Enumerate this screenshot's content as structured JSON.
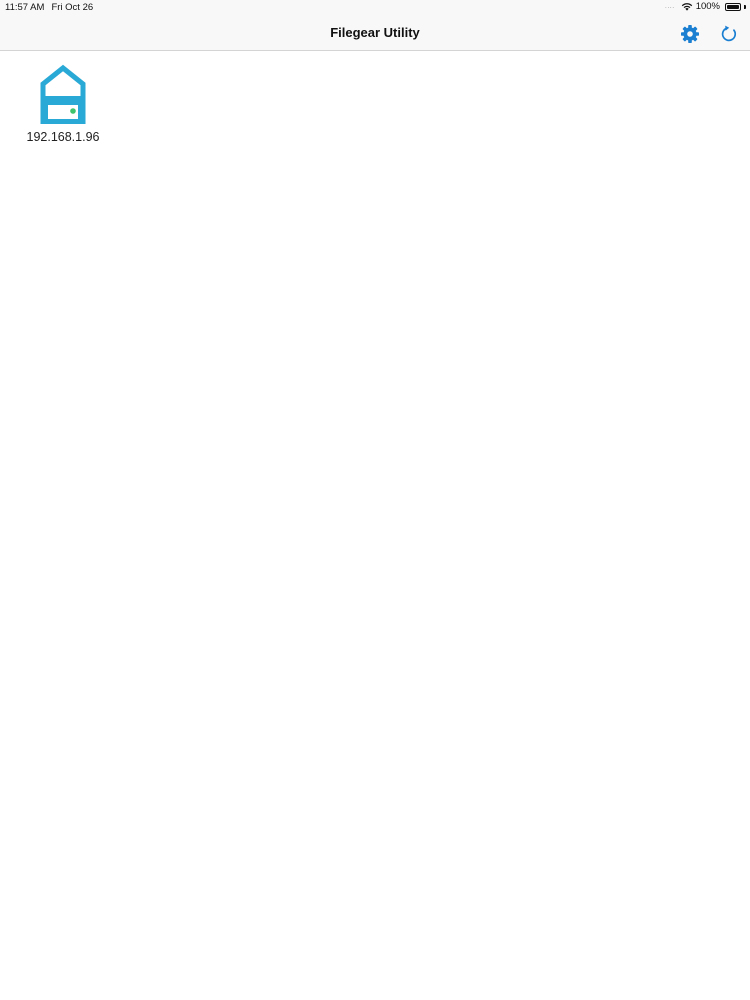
{
  "status_bar": {
    "time": "11:57 AM",
    "date": "Fri Oct 26",
    "signal": "....",
    "wifi_icon": "wifi-icon",
    "battery_percent": "100%",
    "battery_level": 1.0
  },
  "nav_bar": {
    "title": "Filegear Utility",
    "settings_icon": "gear-icon",
    "refresh_icon": "refresh-icon"
  },
  "devices": [
    {
      "label": "192.168.1.96",
      "icon": "nas-device-icon"
    }
  ],
  "colors": {
    "accent": "#1a7fd1",
    "device_icon": "#29a9d6",
    "status_led": "#3ec46d",
    "nav_background": "#f8f8f8"
  }
}
